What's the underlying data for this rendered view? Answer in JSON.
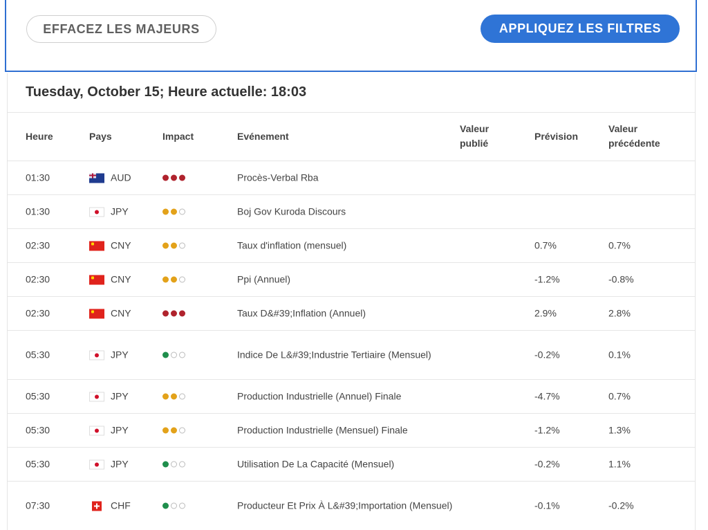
{
  "filters": {
    "clear_label": "EFFACEZ LES MAJEURS",
    "apply_label": "APPLIQUEZ LES FILTRES"
  },
  "calendar": {
    "date_heading": "Tuesday, October 15; Heure actuelle: 18:03",
    "columns": {
      "time": "Heure",
      "country": "Pays",
      "impact": "Impact",
      "event": "Evénement",
      "actual": "Valeur publié",
      "forecast": "Prévision",
      "previous": "Valeur précédente"
    },
    "colors": {
      "high": "#b0232d",
      "medium": "#e3a21a",
      "low": "#1f8e4c"
    },
    "rows": [
      {
        "time": "01:30",
        "currency": "AUD",
        "flag": "aud-flag-icon",
        "impact": "high",
        "impact_level": 3,
        "event": "Procès-Verbal Rba",
        "actual": "",
        "forecast": "",
        "previous": ""
      },
      {
        "time": "01:30",
        "currency": "JPY",
        "flag": "jpy-flag-icon",
        "impact": "medium",
        "impact_level": 2,
        "event": "Boj Gov Kuroda Discours",
        "actual": "",
        "forecast": "",
        "previous": ""
      },
      {
        "time": "02:30",
        "currency": "CNY",
        "flag": "cny-flag-icon",
        "impact": "medium",
        "impact_level": 2,
        "event": "Taux d'inflation (mensuel)",
        "actual": "",
        "forecast": "0.7%",
        "previous": "0.7%"
      },
      {
        "time": "02:30",
        "currency": "CNY",
        "flag": "cny-flag-icon",
        "impact": "medium",
        "impact_level": 2,
        "event": "Ppi (Annuel)",
        "actual": "",
        "forecast": "-1.2%",
        "previous": "-0.8%"
      },
      {
        "time": "02:30",
        "currency": "CNY",
        "flag": "cny-flag-icon",
        "impact": "high",
        "impact_level": 3,
        "event": "Taux D&#39;Inflation (Annuel)",
        "actual": "",
        "forecast": "2.9%",
        "previous": "2.8%"
      },
      {
        "time": "05:30",
        "currency": "JPY",
        "flag": "jpy-flag-icon",
        "impact": "low",
        "impact_level": 1,
        "event": "Indice De L&#39;Industrie Tertiaire (Mensuel)",
        "actual": "",
        "forecast": "-0.2%",
        "previous": "0.1%"
      },
      {
        "time": "05:30",
        "currency": "JPY",
        "flag": "jpy-flag-icon",
        "impact": "medium",
        "impact_level": 2,
        "event": "Production Industrielle (Annuel) Finale",
        "actual": "",
        "forecast": "-4.7%",
        "previous": "0.7%"
      },
      {
        "time": "05:30",
        "currency": "JPY",
        "flag": "jpy-flag-icon",
        "impact": "medium",
        "impact_level": 2,
        "event": "Production Industrielle (Mensuel) Finale",
        "actual": "",
        "forecast": "-1.2%",
        "previous": "1.3%"
      },
      {
        "time": "05:30",
        "currency": "JPY",
        "flag": "jpy-flag-icon",
        "impact": "low",
        "impact_level": 1,
        "event": "Utilisation De La Capacité (Mensuel)",
        "actual": "",
        "forecast": "-0.2%",
        "previous": "1.1%"
      },
      {
        "time": "07:30",
        "currency": "CHF",
        "flag": "chf-flag-icon",
        "impact": "low",
        "impact_level": 1,
        "event": "Producteur Et Prix À L&#39;Importation (Mensuel)",
        "actual": "",
        "forecast": "-0.1%",
        "previous": "-0.2%"
      }
    ]
  }
}
